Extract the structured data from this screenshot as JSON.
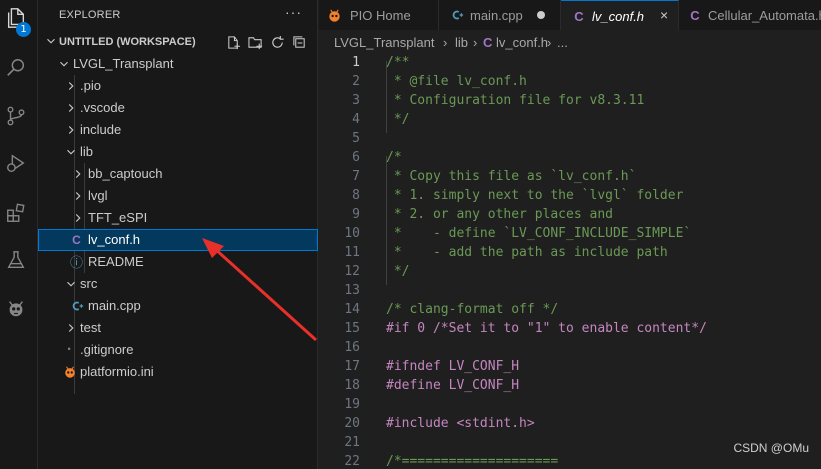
{
  "activity_bar": {
    "items": [
      "files-icon",
      "search-icon",
      "source-control-icon",
      "run-debug-icon",
      "extensions-icon",
      "testing-icon",
      "platformio-icon"
    ],
    "badge": "1"
  },
  "sidebar": {
    "title": "EXPLORER",
    "more": "···",
    "workspace_title": "UNTITLED (WORKSPACE)",
    "tree": [
      {
        "label": "LVGL_Transplant"
      },
      {
        "label": ".pio"
      },
      {
        "label": ".vscode"
      },
      {
        "label": "include"
      },
      {
        "label": "lib"
      },
      {
        "label": "bb_captouch"
      },
      {
        "label": "lvgl"
      },
      {
        "label": "TFT_eSPI"
      },
      {
        "label": "lv_conf.h",
        "icon": "C"
      },
      {
        "label": "README",
        "icon": "ⓘ"
      },
      {
        "label": "src"
      },
      {
        "label": "main.cpp",
        "icon": "C"
      },
      {
        "label": "test"
      },
      {
        "label": ".gitignore"
      },
      {
        "label": "platformio.ini"
      }
    ]
  },
  "tabs": [
    {
      "label": "PIO Home"
    },
    {
      "label": "main.cpp",
      "icon": "G"
    },
    {
      "label": "lv_conf.h",
      "icon": "C",
      "close": "×"
    },
    {
      "label": "Cellular_Automata.h",
      "icon": "C"
    }
  ],
  "breadcrumb": {
    "parts": [
      "LVGL_Transplant",
      "lib",
      "lv_conf.h",
      "..."
    ],
    "separator": "›",
    "icon": "C"
  },
  "editor": {
    "lines": [
      {
        "n": "1",
        "t": "/**"
      },
      {
        "n": "2",
        "t": " * @file lv_conf.h"
      },
      {
        "n": "3",
        "t": " * Configuration file for v8.3.11"
      },
      {
        "n": "4",
        "t": " */"
      },
      {
        "n": "5",
        "t": ""
      },
      {
        "n": "6",
        "t": "/*"
      },
      {
        "n": "7",
        "t": " * Copy this file as `lv_conf.h`"
      },
      {
        "n": "8",
        "t": " * 1. simply next to the `lvgl` folder"
      },
      {
        "n": "9",
        "t": " * 2. or any other places and"
      },
      {
        "n": "10",
        "t": " *    - define `LV_CONF_INCLUDE_SIMPLE`"
      },
      {
        "n": "11",
        "t": " *    - add the path as include path"
      },
      {
        "n": "12",
        "t": " */"
      },
      {
        "n": "13",
        "t": ""
      },
      {
        "n": "14",
        "t": "/* clang-format off */"
      },
      {
        "n": "15",
        "t": "#if 0 /*Set it to \"1\" to enable content*/"
      },
      {
        "n": "16",
        "t": ""
      },
      {
        "n": "17",
        "t": "#ifndef LV_CONF_H"
      },
      {
        "n": "18",
        "t": "#define LV_CONF_H"
      },
      {
        "n": "19",
        "t": ""
      },
      {
        "n": "20",
        "t": "#include <stdint.h>"
      },
      {
        "n": "21",
        "t": ""
      },
      {
        "n": "22",
        "t": "/*===================="
      }
    ]
  },
  "watermark": "CSDN @OMu",
  "colors": {
    "accent": "#0078d4",
    "arrow": "#e8302a"
  }
}
